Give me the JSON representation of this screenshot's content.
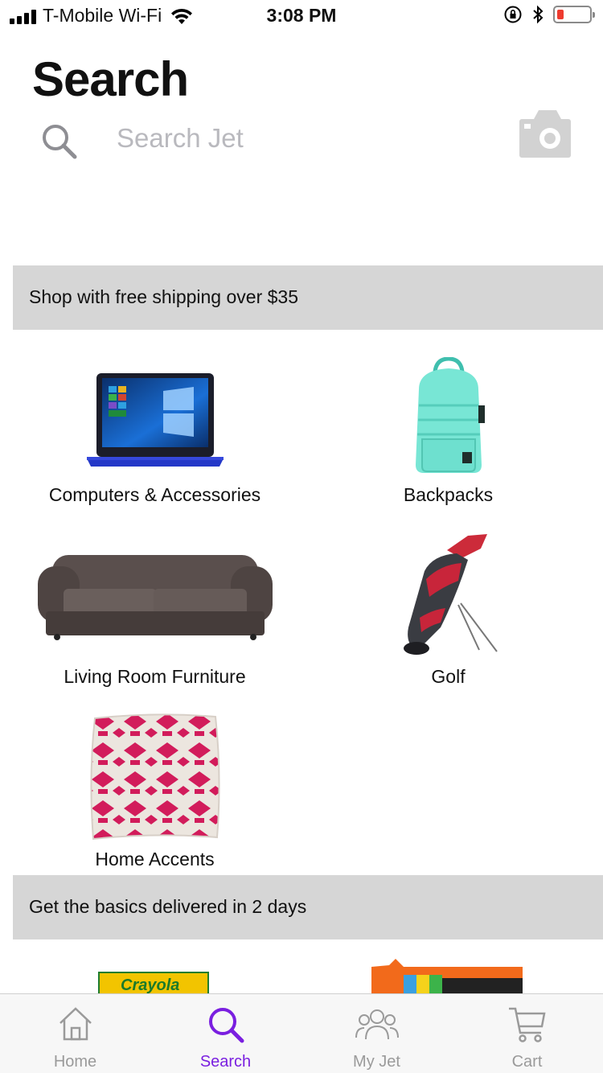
{
  "status_bar": {
    "carrier": "T-Mobile Wi-Fi",
    "time": "3:08 PM",
    "battery_color": "#ee3b2f"
  },
  "header": {
    "title": "Search"
  },
  "search": {
    "placeholder": "Search Jet",
    "value": ""
  },
  "sections": [
    {
      "title": "Shop with free shipping over $35",
      "categories": [
        {
          "label": "Computers & Accessories",
          "icon": "laptop"
        },
        {
          "label": "Backpacks",
          "icon": "backpack"
        },
        {
          "label": "Living Room Furniture",
          "icon": "sofa"
        },
        {
          "label": "Golf",
          "icon": "golf-bag"
        },
        {
          "label": "Home Accents",
          "icon": "pillow"
        }
      ]
    },
    {
      "title": "Get the basics delivered in 2 days",
      "products": [
        {
          "brand_text": "Crayola",
          "icon": "crayola-box"
        },
        {
          "icon": "snack-bar"
        }
      ]
    }
  ],
  "tab_bar": {
    "accent_color": "#7a1fe0",
    "tabs": [
      {
        "label": "Home",
        "icon": "home-icon",
        "active": false
      },
      {
        "label": "Search",
        "icon": "search-icon",
        "active": true
      },
      {
        "label": "My Jet",
        "icon": "people-icon",
        "active": false
      },
      {
        "label": "Cart",
        "icon": "cart-icon",
        "active": false
      }
    ]
  }
}
